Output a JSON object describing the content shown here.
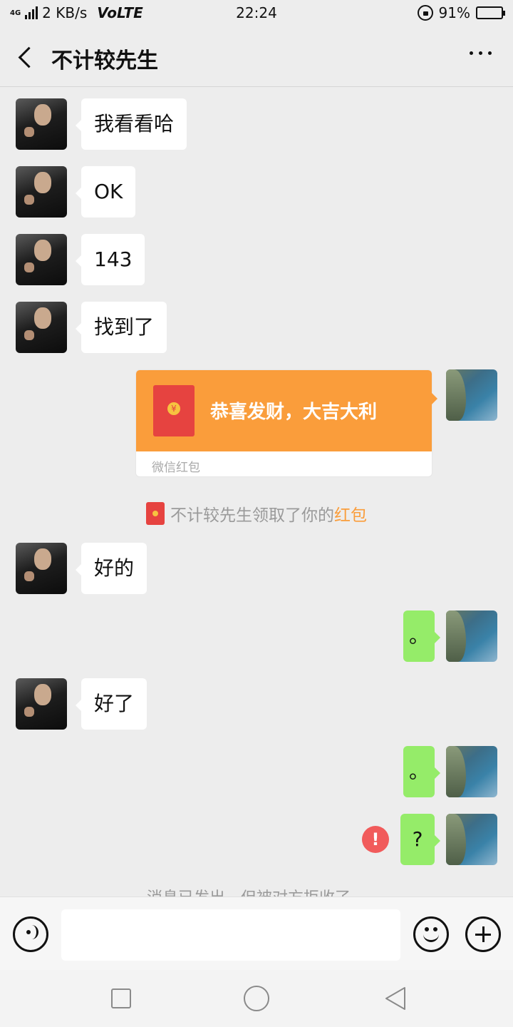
{
  "status_bar": {
    "network_type": "4G",
    "net_speed": "2 KB/s",
    "volte": "VoLTE",
    "time": "22:24",
    "battery_percent": "91%",
    "battery_level": 0.91,
    "battery_color": "#2ecc40"
  },
  "header": {
    "title": "不计较先生"
  },
  "messages": [
    {
      "side": "in",
      "text": "我看看哈"
    },
    {
      "side": "in",
      "text": "OK"
    },
    {
      "side": "in",
      "text": "143"
    },
    {
      "side": "in",
      "text": "找到了"
    },
    {
      "side": "out",
      "type": "red_packet",
      "wish": "恭喜发财，大吉大利",
      "label": "微信红包"
    },
    {
      "side": "in",
      "text": "好的"
    },
    {
      "side": "out",
      "text": "。"
    },
    {
      "side": "in",
      "text": "好了"
    },
    {
      "side": "out",
      "text": "。"
    },
    {
      "side": "out",
      "text": "?",
      "status": "failed"
    }
  ],
  "notice": {
    "prefix": "不计较先生领取了你的",
    "link": "红包"
  },
  "reject_notice": "消息已发出，但被对方拒收了。",
  "input_bar": {
    "value": ""
  },
  "colors": {
    "bubble_out": "#95ec69",
    "red_packet": "#fa9d3b",
    "error": "#f15b5b",
    "background": "#ededed"
  }
}
